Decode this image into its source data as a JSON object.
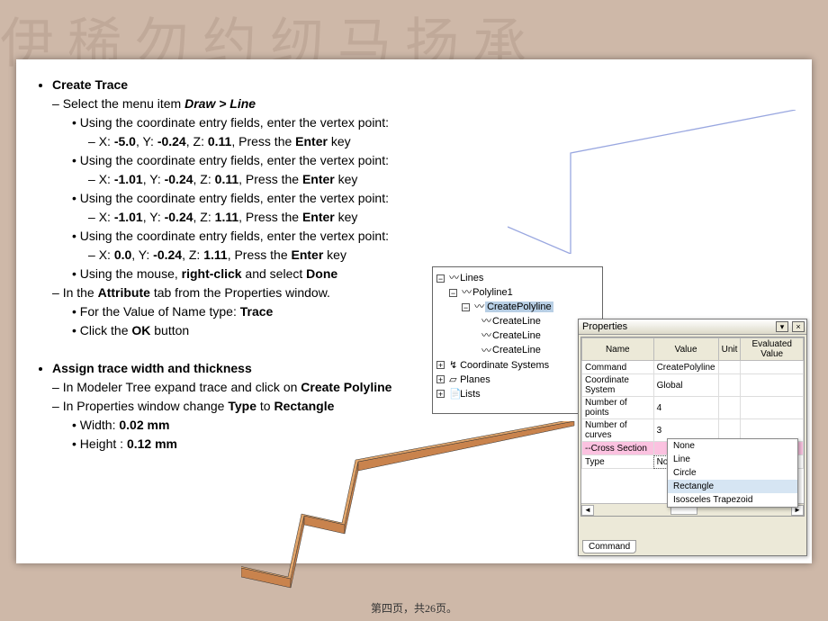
{
  "footer": "第四页，共26页。",
  "sections": {
    "h1": "Create Trace",
    "menuitem_pre": "Select the menu item ",
    "menuitem": "Draw > Line",
    "entryline": "Using the coordinate entry fields, enter the vertex point:",
    "coords": [
      {
        "p": "X: ",
        "x": "-5.0",
        "c1": ", Y: ",
        "y": "-0.24",
        "c2": ", Z: ",
        "z": "0.11",
        "tail": ", Press the "
      },
      {
        "p": "X: ",
        "x": "-1.01",
        "c1": ", Y: ",
        "y": "-0.24",
        "c2": ", Z: ",
        "z": "0.11",
        "tail": ", Press the "
      },
      {
        "p": "X: ",
        "x": "-1.01",
        "c1": ", Y: ",
        "y": "-0.24",
        "c2": ", Z: ",
        "z": "1.11",
        "tail": ", Press the "
      },
      {
        "p": "X: ",
        "x": "0.0",
        "c1": ", Y: ",
        "y": "-0.24",
        "c2": ", Z: ",
        "z": "1.11",
        "tail": ", Press the "
      }
    ],
    "enter": "Enter",
    "keyword": " key",
    "rc_pre": "Using the mouse, ",
    "rc_b": "right-click",
    "rc_mid": " and select ",
    "rc_done": "Done",
    "attr_pre": "In the ",
    "attr_b": "Attribute",
    "attr_post": " tab from the Properties window.",
    "name_pre": "For the Value of Name type: ",
    "name_val": "Trace",
    "ok_pre": "Click the ",
    "ok_b": "OK",
    "ok_post": " button",
    "h2": "Assign trace width and thickness",
    "l1_pre": "In Modeler Tree expand trace and click on ",
    "l1_b": "Create Polyline",
    "l2_pre": "In Properties window change ",
    "l2_b1": "Type",
    "l2_mid": " to ",
    "l2_b2": "Rectangle",
    "w_pre": "Width: ",
    "w_v": "0.02 mm",
    "h_pre": "Height : ",
    "h_v": "0.12 mm"
  },
  "tree": {
    "lines": "Lines",
    "poly": "Polyline1",
    "create": "CreatePolyline",
    "cline": "CreateLine",
    "coord": "Coordinate Systems",
    "planes": "Planes",
    "lists": "Lists"
  },
  "props": {
    "title": "Properties",
    "cols": [
      "Name",
      "Value",
      "Unit",
      "Evaluated Value"
    ],
    "rows": [
      {
        "n": "Command",
        "v": "CreatePolyline"
      },
      {
        "n": "Coordinate System",
        "v": "Global"
      },
      {
        "n": "Number of points",
        "v": "4"
      },
      {
        "n": "Number of curves",
        "v": "3"
      }
    ],
    "section": "--Cross Section",
    "trow": {
      "n": "Type",
      "v": "None"
    },
    "opts": [
      "None",
      "Line",
      "Circle",
      "Rectangle",
      "Isosceles Trapezoid"
    ],
    "tab": "Command"
  }
}
